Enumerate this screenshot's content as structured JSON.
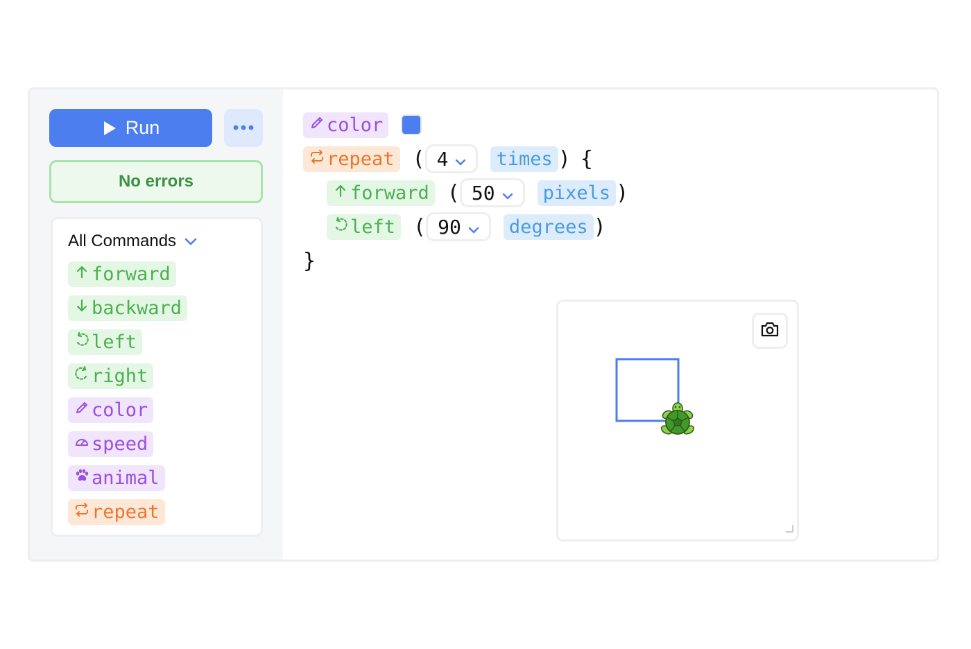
{
  "toolbar": {
    "run_label": "Run",
    "run_icon": "play-icon",
    "more_icon": "more-dots-icon"
  },
  "status": {
    "text": "No errors",
    "color": "#3d8f44"
  },
  "commands": {
    "header": "All Commands",
    "items": [
      {
        "label": "forward",
        "icon": "arrow-up-icon",
        "category": "motion"
      },
      {
        "label": "backward",
        "icon": "arrow-down-icon",
        "category": "motion"
      },
      {
        "label": "left",
        "icon": "rotate-left-icon",
        "category": "motion"
      },
      {
        "label": "right",
        "icon": "rotate-right-icon",
        "category": "motion"
      },
      {
        "label": "color",
        "icon": "pencil-icon",
        "category": "pen"
      },
      {
        "label": "speed",
        "icon": "speedometer-icon",
        "category": "pen"
      },
      {
        "label": "animal",
        "icon": "paw-icon",
        "category": "pen"
      },
      {
        "label": "repeat",
        "icon": "repeat-icon",
        "category": "control"
      }
    ]
  },
  "program": {
    "color_cmd": "color",
    "color_value": "#4d7ef0",
    "repeat_cmd": "repeat",
    "repeat_count": "4",
    "repeat_unit": "times",
    "open_paren": "(",
    "close_paren": ")",
    "open_brace": "{",
    "close_brace": "}",
    "forward_cmd": "forward",
    "forward_value": "50",
    "forward_unit": "pixels",
    "left_cmd": "left",
    "left_value": "90",
    "left_unit": "degrees"
  },
  "canvas": {
    "pen_color": "#4d7ef0",
    "animal": "turtle",
    "camera_icon": "camera-icon"
  },
  "colors": {
    "motion": "#4cb050",
    "pen": "#9b4fe0",
    "control": "#e9782b",
    "value": "#4a9be0",
    "primary": "#4d7ef0"
  }
}
